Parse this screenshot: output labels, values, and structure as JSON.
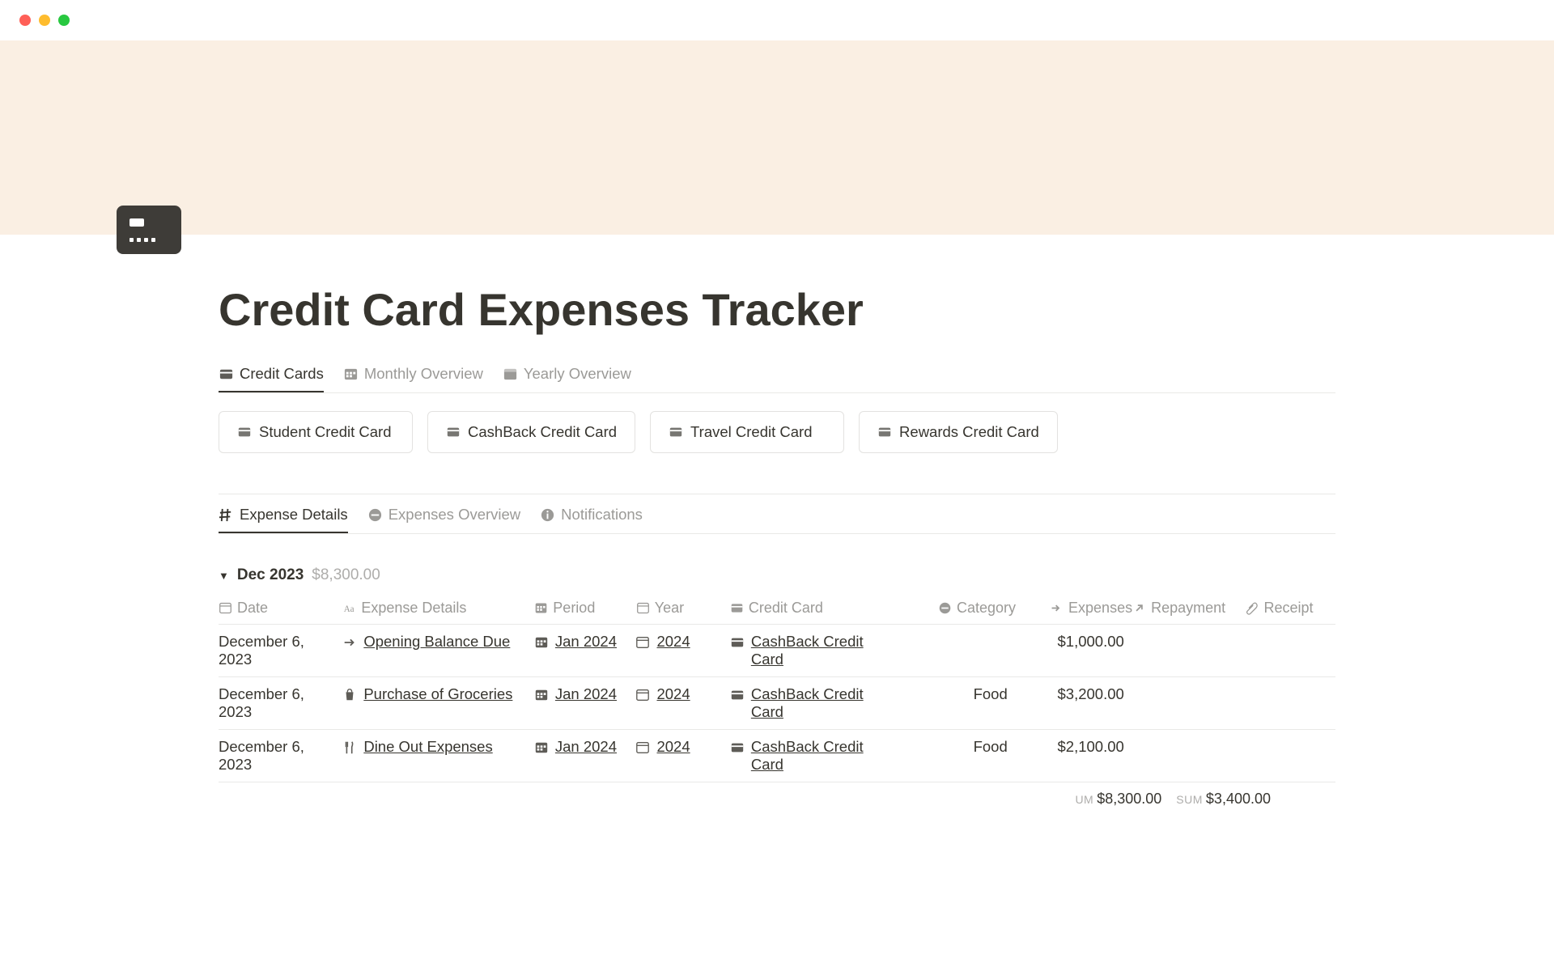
{
  "page": {
    "title": "Credit Card Expenses Tracker"
  },
  "main_tabs": [
    {
      "label": "Credit Cards",
      "icon": "card",
      "active": true
    },
    {
      "label": "Monthly Overview",
      "icon": "calendar-grid",
      "active": false
    },
    {
      "label": "Yearly Overview",
      "icon": "calendar",
      "active": false
    }
  ],
  "credit_cards": [
    {
      "name": "Student Credit Card"
    },
    {
      "name": "CashBack Credit Card"
    },
    {
      "name": "Travel Credit Card"
    },
    {
      "name": "Rewards Credit Card"
    }
  ],
  "detail_tabs": [
    {
      "label": "Expense Details",
      "icon": "hash",
      "active": true
    },
    {
      "label": "Expenses Overview",
      "icon": "no-entry",
      "active": false
    },
    {
      "label": "Notifications",
      "icon": "info",
      "active": false
    }
  ],
  "group": {
    "name": "Dec 2023",
    "total": "$8,300.00"
  },
  "columns": {
    "date": "Date",
    "expense": "Expense Details",
    "period": "Period",
    "year": "Year",
    "card": "Credit Card",
    "category": "Category",
    "expenses": "Expenses",
    "repayment": "Repayment",
    "receipt": "Receipt"
  },
  "rows": [
    {
      "date": "December 6, 2023",
      "expense": "Opening Balance Due",
      "expense_icon": "arrow-right",
      "period": "Jan 2024",
      "year": "2024",
      "card": "CashBack Credit Card",
      "category": "",
      "expenses": "$1,000.00"
    },
    {
      "date": "December 6, 2023",
      "expense": "Purchase of Groceries",
      "expense_icon": "shopping-bag",
      "period": "Jan 2024",
      "year": "2024",
      "card": "CashBack Credit Card",
      "category": "Food",
      "expenses": "$3,200.00"
    },
    {
      "date": "December 6, 2023",
      "expense": "Dine Out Expenses",
      "expense_icon": "utensils",
      "period": "Jan 2024",
      "year": "2024",
      "card": "CashBack Credit Card",
      "category": "Food",
      "expenses": "$2,100.00"
    }
  ],
  "footer": {
    "sum1_label": "UM",
    "sum1_value": "$8,300.00",
    "sum2_label": "SUM",
    "sum2_value": "$3,400.00"
  }
}
